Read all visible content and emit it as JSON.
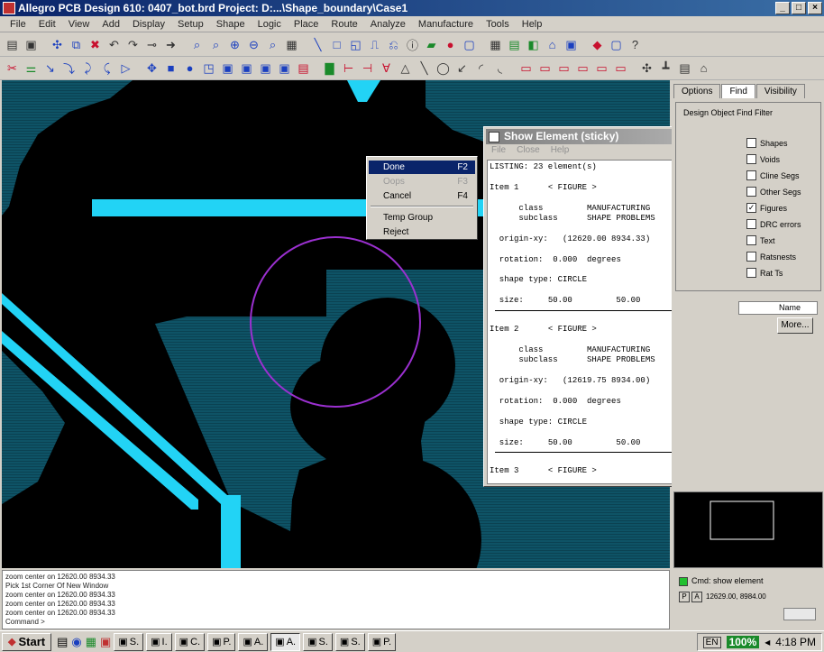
{
  "window": {
    "title": "Allegro PCB Design 610: 0407_bot.brd  Project: D:...\\Shape_boundary\\Case1"
  },
  "menubar": [
    "File",
    "Edit",
    "View",
    "Add",
    "Display",
    "Setup",
    "Shape",
    "Logic",
    "Place",
    "Route",
    "Analyze",
    "Manufacture",
    "Tools",
    "Help"
  ],
  "right_panel": {
    "tabs": [
      "Options",
      "Find",
      "Visibility"
    ],
    "find_filter_label": "Design Object Find Filter",
    "checkboxes": [
      {
        "label": "Shapes",
        "checked": ""
      },
      {
        "label": "Voids",
        "checked": ""
      },
      {
        "label": "Cline Segs",
        "checked": ""
      },
      {
        "label": "Other Segs",
        "checked": ""
      },
      {
        "label": "Figures",
        "checked": "✓"
      },
      {
        "label": "DRC errors",
        "checked": ""
      },
      {
        "label": "Text",
        "checked": ""
      },
      {
        "label": "Ratsnests",
        "checked": ""
      },
      {
        "label": "Rat Ts",
        "checked": ""
      }
    ],
    "name_select": "Name",
    "more_button": "More..."
  },
  "context_menu": {
    "items": [
      {
        "label": "Done",
        "key": "F2",
        "state": "hl"
      },
      {
        "label": "Oops",
        "key": "F3",
        "state": "dis"
      },
      {
        "label": "Cancel",
        "key": "F4",
        "state": ""
      },
      {
        "label": "Temp Group",
        "key": "",
        "state": ""
      },
      {
        "label": "Reject",
        "key": "",
        "state": ""
      }
    ]
  },
  "show_element": {
    "title": "Show Element (sticky)",
    "menu": [
      "File",
      "Close",
      "Help"
    ],
    "header": "LISTING: 23 element(s)",
    "items": [
      {
        "name": "Item 1",
        "type": "< FIGURE >",
        "class": "MANUFACTURING",
        "subclass": "SHAPE PROBLEMS",
        "origin": "(12620.00 8934.33)",
        "rotation": "0.000",
        "shape": "CIRCLE",
        "size": "50.00         50.00"
      },
      {
        "name": "Item 2",
        "type": "< FIGURE >",
        "class": "MANUFACTURING",
        "subclass": "SHAPE PROBLEMS",
        "origin": "(12619.75 8934.00)",
        "rotation": "0.000",
        "shape": "CIRCLE",
        "size": "50.00         50.00"
      },
      {
        "name": "Item 3",
        "type": "< FIGURE >"
      }
    ]
  },
  "command_window": [
    "zoom center on 12620.00 8934.33",
    "Pick 1st Corner Of New Window",
    "zoom center on 12620.00 8934.33",
    "zoom center on 12620.00 8934.33",
    "zoom center on 12620.00 8934.33",
    "Command >"
  ],
  "status": {
    "cmd_label": "Cmd:",
    "cmd_value": "show element",
    "coords": "12629.00, 8984.00"
  },
  "taskbar": {
    "start": "Start",
    "tasks": [
      "S.",
      "I.",
      "C.",
      "P.",
      "A.",
      "A.",
      "S.",
      "S.",
      "P."
    ],
    "zoom": "100%",
    "lang": "EN",
    "clock": "4:18 PM"
  },
  "colors": {
    "copper": "#0f5a6e",
    "trace": "#22d3f5",
    "circle": "#9b30d0",
    "highlight": "#0a246a"
  }
}
